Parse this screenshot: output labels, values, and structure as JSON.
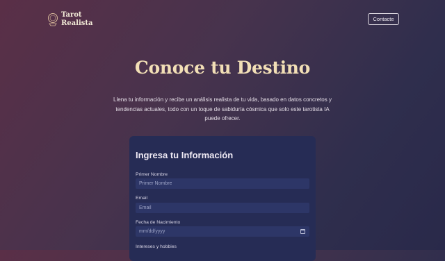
{
  "brand": {
    "name_line1": "Tarot",
    "name_line2": "Realista",
    "icon": "crystal-ball-icon"
  },
  "nav": {
    "contact_label": "Contacte"
  },
  "hero": {
    "title": "Conoce tu Destino",
    "description": "Llena tu información y recibe un análisis realista de tu vida, basado en datos concretos y tendencias actuales, todo con un toque de sabiduría cósmica que solo este tarotista IA puede ofrecer."
  },
  "form": {
    "title": "Ingresa tu Información",
    "fields": [
      {
        "label": "Primer Nombre",
        "placeholder": "Primer Nombre"
      },
      {
        "label": "Email",
        "placeholder": "Email"
      },
      {
        "label": "Fecha de Nacimiento",
        "placeholder": "mm/dd/yyyy"
      },
      {
        "label": "Intereses y hobbies"
      }
    ]
  },
  "colors": {
    "accent_title": "#f2dfb6",
    "card_bg": "#262c55",
    "input_bg": "#2d3667"
  }
}
